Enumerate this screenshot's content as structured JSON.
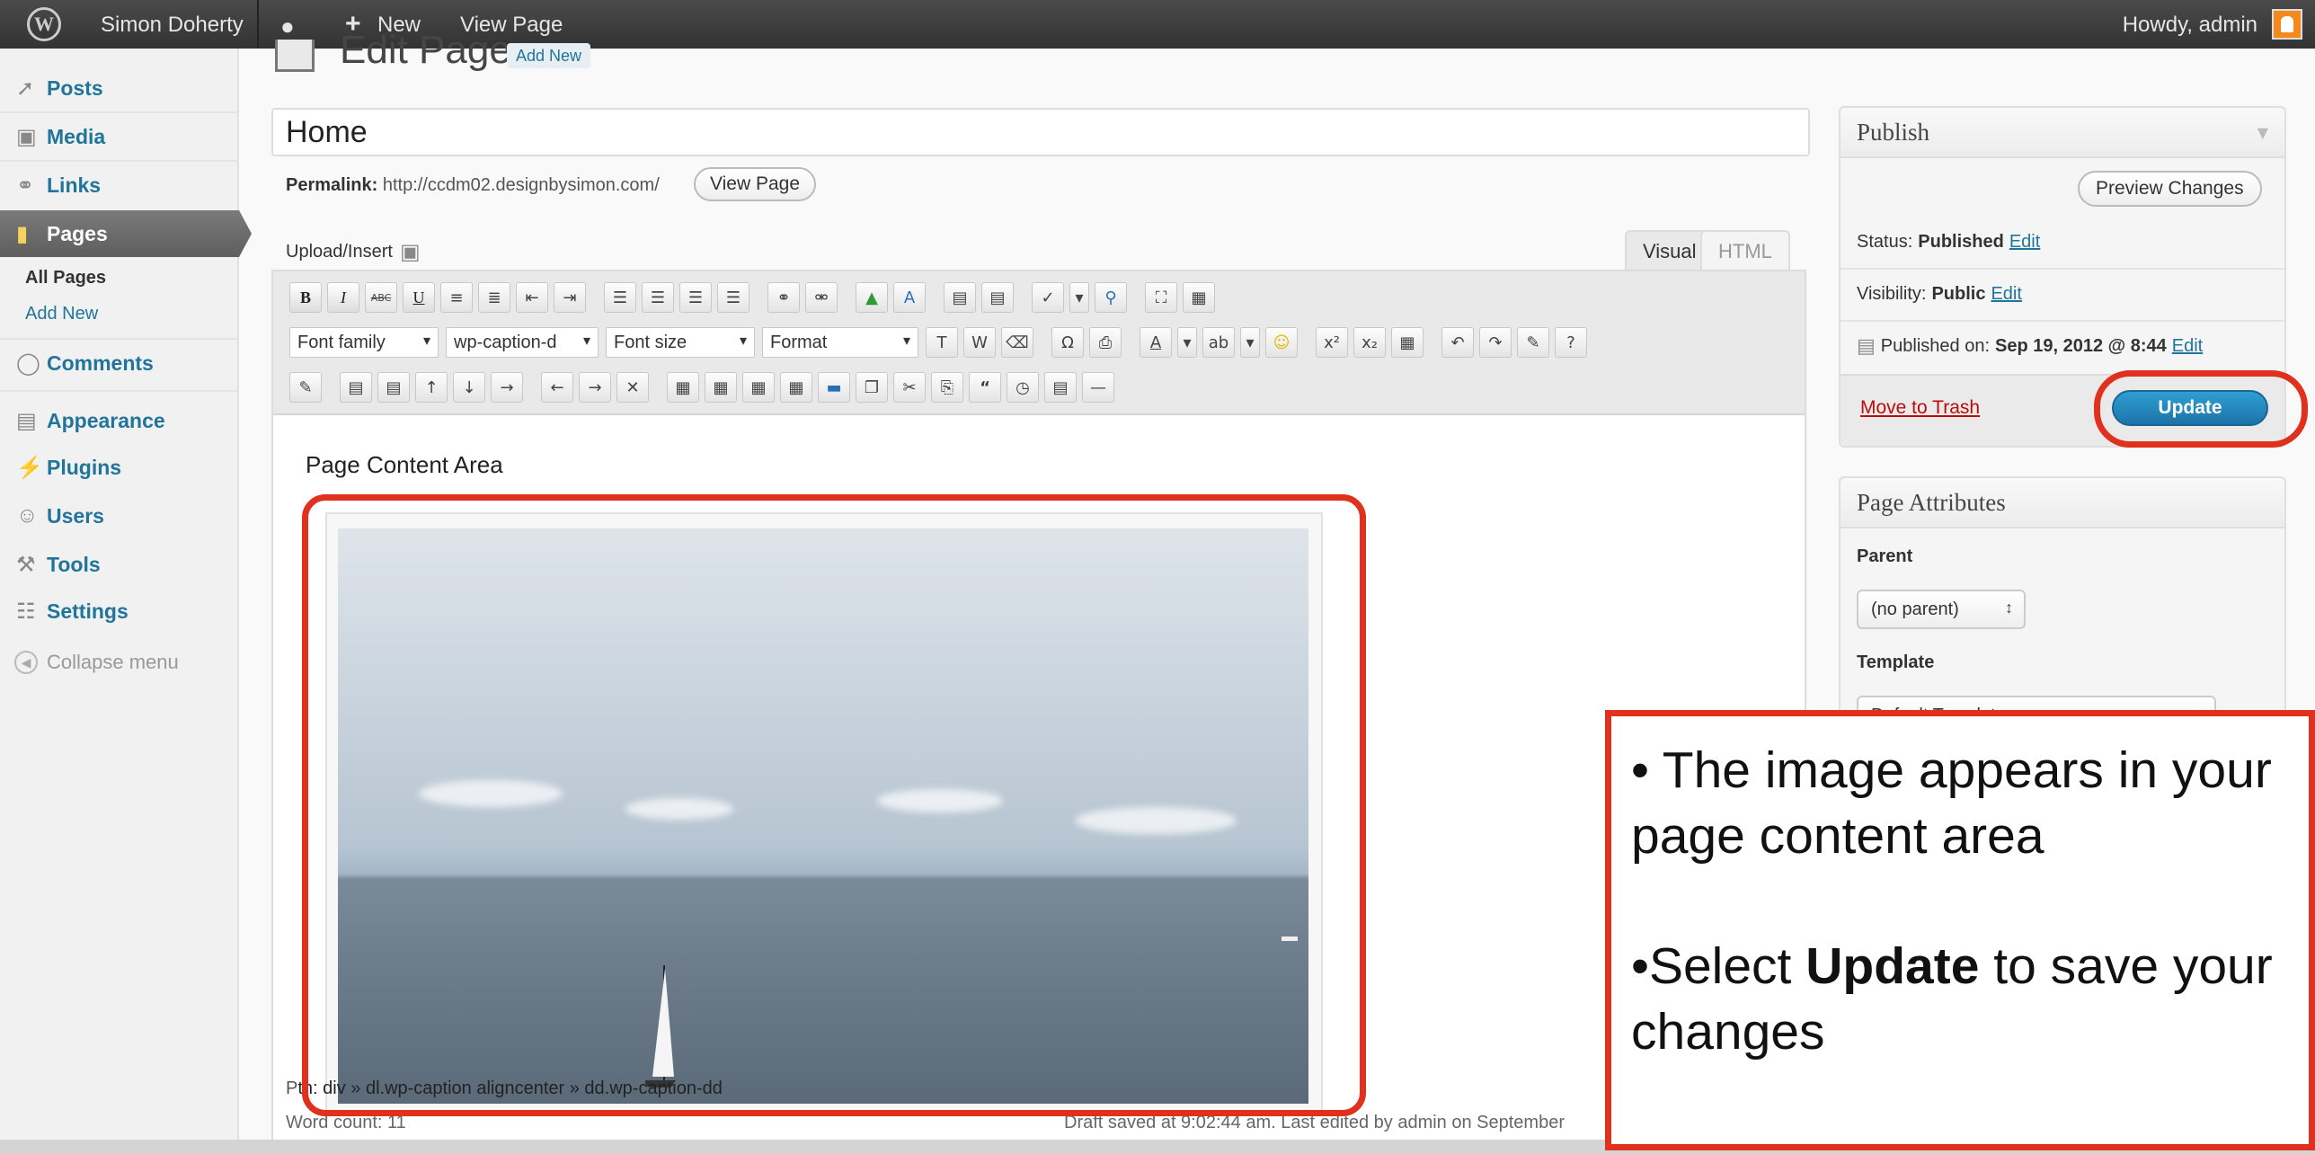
{
  "adminbar": {
    "site_name": "Simon Doherty",
    "new_label": "New",
    "view_page": "View Page",
    "howdy": "Howdy, admin"
  },
  "sidebar": {
    "items": [
      {
        "label": "Posts",
        "icon": "pin-icon"
      },
      {
        "label": "Media",
        "icon": "media-icon"
      },
      {
        "label": "Links",
        "icon": "link-icon"
      },
      {
        "label": "Pages",
        "icon": "pages-icon"
      },
      {
        "label": "Comments",
        "icon": "comment-icon"
      },
      {
        "label": "Appearance",
        "icon": "appearance-icon"
      },
      {
        "label": "Plugins",
        "icon": "plugin-icon"
      },
      {
        "label": "Users",
        "icon": "users-icon"
      },
      {
        "label": "Tools",
        "icon": "tools-icon"
      },
      {
        "label": "Settings",
        "icon": "settings-icon"
      }
    ],
    "submenu": [
      "All Pages",
      "Add New"
    ],
    "collapse": "Collapse menu"
  },
  "main": {
    "heading": "Edit Page",
    "add_new": "Add New",
    "title_value": "Home",
    "permalink_label": "Permalink:",
    "permalink_url": "http://ccdm02.designbysimon.com/",
    "view_page_button": "View Page",
    "upload_insert": "Upload/Insert",
    "tabs": [
      "Visual",
      "HTML"
    ],
    "toolbar": {
      "font_family": "Font family",
      "style": "wp-caption-d",
      "font_size": "Font size",
      "format": "Format"
    },
    "content_label": "Page Content Area",
    "path_prefix": "P",
    "path_value": "th: div » dl.wp-caption aligncenter » dd.wp-caption-dd",
    "word_count": "Word count: 11",
    "draft_saved": "Draft saved at 9:02:44 am. Last edited by admin on September"
  },
  "publish": {
    "title": "Publish",
    "preview": "Preview Changes",
    "status_label": "Status:",
    "status_value": "Published",
    "visibility_label": "Visibility:",
    "visibility_value": "Public",
    "published_label": "Published on:",
    "published_value": "Sep 19, 2012 @ 8:44",
    "edit": "Edit",
    "trash": "Move to Trash",
    "update": "Update"
  },
  "attributes": {
    "title": "Page Attributes",
    "parent_label": "Parent",
    "parent_value": "(no parent)",
    "template_label": "Template",
    "template_value": "Default Template"
  },
  "callout": {
    "line1": "• The image appears in your page content area",
    "line2_pre": "•Select ",
    "line2_bold": "Update",
    "line2_post": " to save your changes"
  },
  "colors": {
    "accent_red": "#e0301e",
    "link_blue": "#21759b",
    "update_blue": "#1e73a8"
  }
}
